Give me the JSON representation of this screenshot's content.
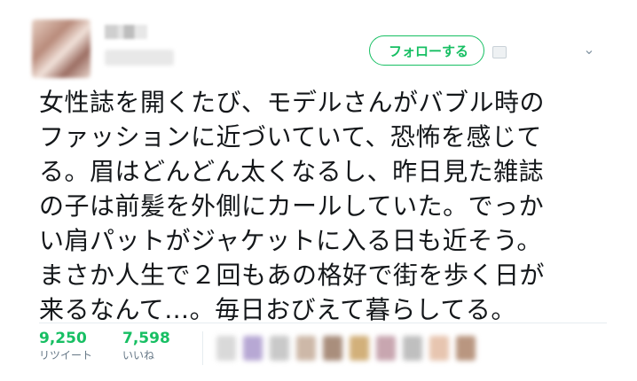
{
  "header": {
    "follow_label": "フォローする"
  },
  "tweet": {
    "text": "女性誌を開くたび、モデルさんがバブル時の\nファッションに近づいていて、恐怖を感じて\nる。眉はどんどん太くなるし、昨日見た雑誌\nの子は前髪を外側にカールしていた。でっか\nい肩パットがジャケットに入る日も近そう。\nまさか人生で２回もあの格好で街を歩く日が\n来るなんて…。毎日おびえて暮らしてる。"
  },
  "stats": {
    "retweets": {
      "count": "9,250",
      "label": "リツイート"
    },
    "likes": {
      "count": "7,598",
      "label": "いいね"
    }
  },
  "colors": {
    "accent_green": "#17bf63",
    "muted": "#657786",
    "text": "#14171a"
  },
  "likers": [
    {
      "color": "#d9d9d9"
    },
    {
      "color": "#b7a8d4"
    },
    {
      "color": "#c9c9c9"
    },
    {
      "color": "#cdb8a8"
    },
    {
      "color": "#a98e7c"
    },
    {
      "color": "#d2b07a"
    },
    {
      "color": "#c8a6b0"
    },
    {
      "color": "#bfbfbf"
    },
    {
      "color": "#e7c5b0"
    },
    {
      "color": "#b99680"
    }
  ]
}
